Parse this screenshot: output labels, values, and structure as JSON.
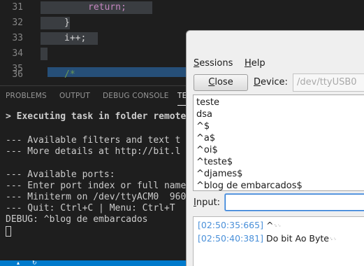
{
  "editor": {
    "lines": [
      {
        "num": "31",
        "code": "return;"
      },
      {
        "num": "32",
        "code": "}"
      },
      {
        "num": "33",
        "code": "i++;"
      },
      {
        "num": "34",
        "code": ""
      },
      {
        "num": "35",
        "code": ""
      },
      {
        "num": "36",
        "code": "/*"
      }
    ]
  },
  "panel": {
    "tabs": [
      "PROBLEMS",
      "OUTPUT",
      "DEBUG CONSOLE",
      "TE"
    ],
    "terminal_lines": [
      "> Executing task in folder remote",
      "",
      "--- Available filters and text t",
      "--- More details at http://bit.l",
      "",
      "--- Available ports:",
      "--- Enter port index or full name",
      "--- Miniterm on /dev/ttyACM0  960",
      "--- Quit: Ctrl+C | Menu: Ctrl+T",
      "DEBUG: ^blog de embarcados"
    ]
  },
  "miniterm": {
    "menu": {
      "sessions": "Sessions",
      "help": "Help"
    },
    "close_label": "Close",
    "device_label": "Device:",
    "device_value": "/dev/ttyUSB0",
    "history": [
      "teste",
      "dsa",
      "^$",
      "^a$",
      "^oi$",
      "^teste$",
      "^djames$",
      "^blog de embarcados$"
    ],
    "input_label": "Input:",
    "input_value": "",
    "output": [
      {
        "time": "[02:50:35:665]",
        "text": "^",
        "ctrl": "␍␊"
      },
      {
        "time": "[02:50:40:381]",
        "text": "Do bit Ao Byte",
        "ctrl": "␍␊"
      }
    ]
  },
  "colors": {
    "editor_bg": "#1e1e1e",
    "keyword": "#c586c0",
    "comment": "#6a9955",
    "status_bar": "#007acc",
    "timestamp": "#4a90d9",
    "input_focus": "#2f7bd1"
  }
}
